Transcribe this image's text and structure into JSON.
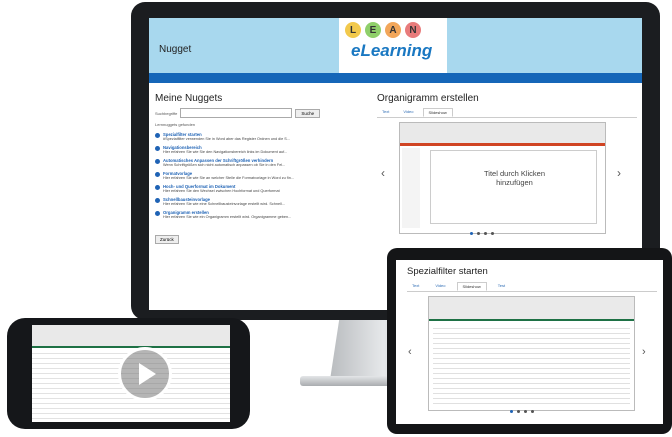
{
  "app": {
    "nugget_label": "Nugget"
  },
  "logo": {
    "letters": [
      "L",
      "E",
      "A",
      "N"
    ],
    "letter_colors": [
      "#f2c94c",
      "#8fcf6a",
      "#f2a65a",
      "#e87b7b"
    ],
    "word": "eLearning"
  },
  "left": {
    "heading": "Meine Nuggets",
    "search_label": "Suchbegriffe",
    "search_button": "Suche",
    "list_header": "Lernnuggets gefunden",
    "items": [
      {
        "title": "Spezialfilter starten",
        "desc": "#Spezialfilter verwenden Sie in Word aber das Register Ordnen und die S..."
      },
      {
        "title": "Navigationsbereich",
        "desc": "Hier erfahren Sie wie Sie den Navigationsbereich links im Dokument auf..."
      },
      {
        "title": "Automatisches Anpassen der Schriftgrößen verhindern",
        "desc": "Wenn Schriftgrößen sich nicht automatisch anpassen ob Sie in den Fel..."
      },
      {
        "title": "Formatvorlage",
        "desc": "Hier erfahren Sie wie Sie an welcher Stelle die Formatvorlage in Word zu fin..."
      },
      {
        "title": "Hoch- und Querformat im Dokument",
        "desc": "Hier erfahren Sie den Wechsel zwischen Hochformat und Querformat"
      },
      {
        "title": "Schnellbausteinvorlage",
        "desc": "Hier erfahren Sie wie eine Schnellbausteinvorlage erstellt wird. Schnell..."
      },
      {
        "title": "Organigramm erstellen",
        "desc": "Hier erfahren Sie wie ein Organigramm erstellt wird. Organigramme geben..."
      }
    ],
    "back_button": "Zurück"
  },
  "right": {
    "heading": "Organigramm erstellen",
    "tabs": [
      "Text",
      "Video",
      "Slideshow"
    ],
    "slide_title": "Titel durch Klicken hinzufügen"
  },
  "tablet": {
    "heading": "Spezialfilter starten",
    "tabs": [
      "Text",
      "Video",
      "Slideshow",
      "Test"
    ]
  },
  "phone": {
    "play_label": "play"
  }
}
